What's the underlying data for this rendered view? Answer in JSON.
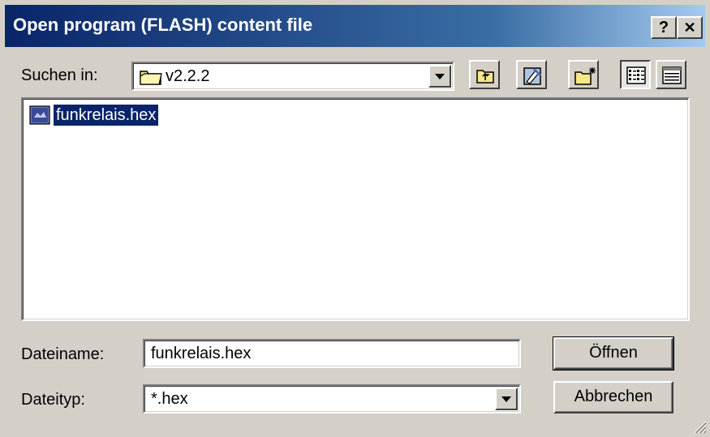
{
  "dialog": {
    "title": "Open program (FLASH) content file",
    "help_glyph": "?",
    "close_glyph": "✕"
  },
  "look_in": {
    "label": "Suchen in:",
    "value": "v2.2.2",
    "folder_icon": "folder-icon"
  },
  "toolbar": {
    "icons": [
      "up-one-level-icon",
      "favorites-icon",
      "new-folder-icon",
      "list-view-icon",
      "details-view-icon"
    ]
  },
  "files": [
    {
      "name": "funkrelais.hex",
      "icon": "hex-file-icon",
      "selected": true
    }
  ],
  "filename": {
    "label": "Dateiname:",
    "value": "funkrelais.hex"
  },
  "filetype": {
    "label": "Dateityp:",
    "value": "*.hex"
  },
  "buttons": {
    "open": "Öffnen",
    "cancel": "Abbrechen"
  },
  "colors": {
    "titlebar_start": "#0a246a",
    "titlebar_end": "#a6caf0",
    "face": "#d4d0c8",
    "selection": "#0a246a"
  }
}
